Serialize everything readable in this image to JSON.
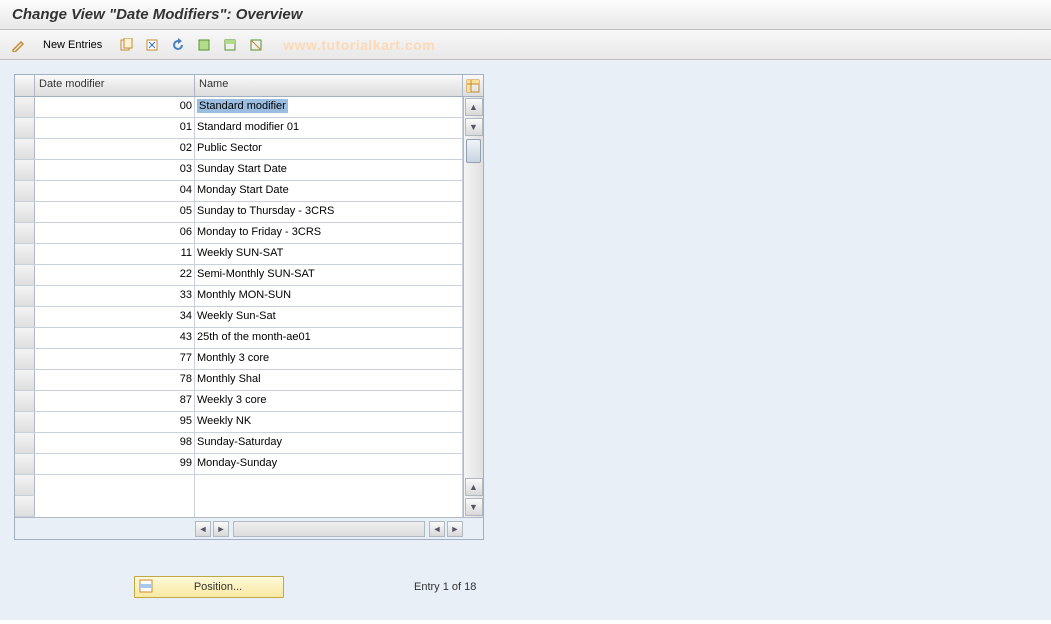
{
  "title": "Change View \"Date Modifiers\": Overview",
  "toolbar": {
    "new_entries_label": "New Entries"
  },
  "watermark": "www.tutorialkart.com",
  "columns": {
    "col1": "Date modifier",
    "col2": "Name"
  },
  "rows": [
    {
      "id": "00",
      "name": "Standard modifier",
      "selected": true
    },
    {
      "id": "01",
      "name": "Standard modifier 01"
    },
    {
      "id": "02",
      "name": "Public Sector"
    },
    {
      "id": "03",
      "name": "Sunday Start Date"
    },
    {
      "id": "04",
      "name": "Monday Start Date"
    },
    {
      "id": "05",
      "name": "Sunday to Thursday - 3CRS"
    },
    {
      "id": "06",
      "name": "Monday to Friday - 3CRS"
    },
    {
      "id": "11",
      "name": "Weekly SUN-SAT"
    },
    {
      "id": "22",
      "name": "Semi-Monthly SUN-SAT"
    },
    {
      "id": "33",
      "name": "Monthly MON-SUN"
    },
    {
      "id": "34",
      "name": "Weekly Sun-Sat"
    },
    {
      "id": "43",
      "name": "25th of the month-ae01"
    },
    {
      "id": "77",
      "name": "Monthly 3 core"
    },
    {
      "id": "78",
      "name": "Monthly Shal"
    },
    {
      "id": "87",
      "name": "Weekly 3 core"
    },
    {
      "id": "95",
      "name": "Weekly NK"
    },
    {
      "id": "98",
      "name": "Sunday-Saturday"
    },
    {
      "id": "99",
      "name": "Monday-Sunday"
    }
  ],
  "footer": {
    "position_label": "Position...",
    "entry_label": "Entry 1 of 18"
  }
}
